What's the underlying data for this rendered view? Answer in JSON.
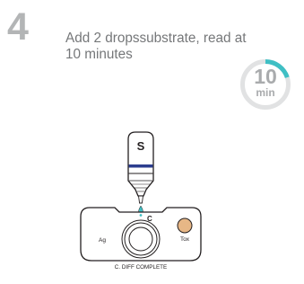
{
  "step": {
    "number": "4",
    "instruction": "Add 2 dropssubstrate, read at 10 minutes"
  },
  "timer": {
    "value": "10",
    "unit": "min",
    "ring_color": "#e1e2e3",
    "progress_color": "#3fbfc4"
  },
  "bottle": {
    "label": "S",
    "band_color": "#2c3e8f"
  },
  "device": {
    "port_c": "C",
    "port_ag": "Ag",
    "port_tox": "Tox",
    "name": "C. DIFF COMPLETE",
    "tox_dot_color": "#e7b786"
  },
  "colors": {
    "step_number": "#b3b5b6",
    "text": "#757779",
    "outline": "#231f20"
  }
}
